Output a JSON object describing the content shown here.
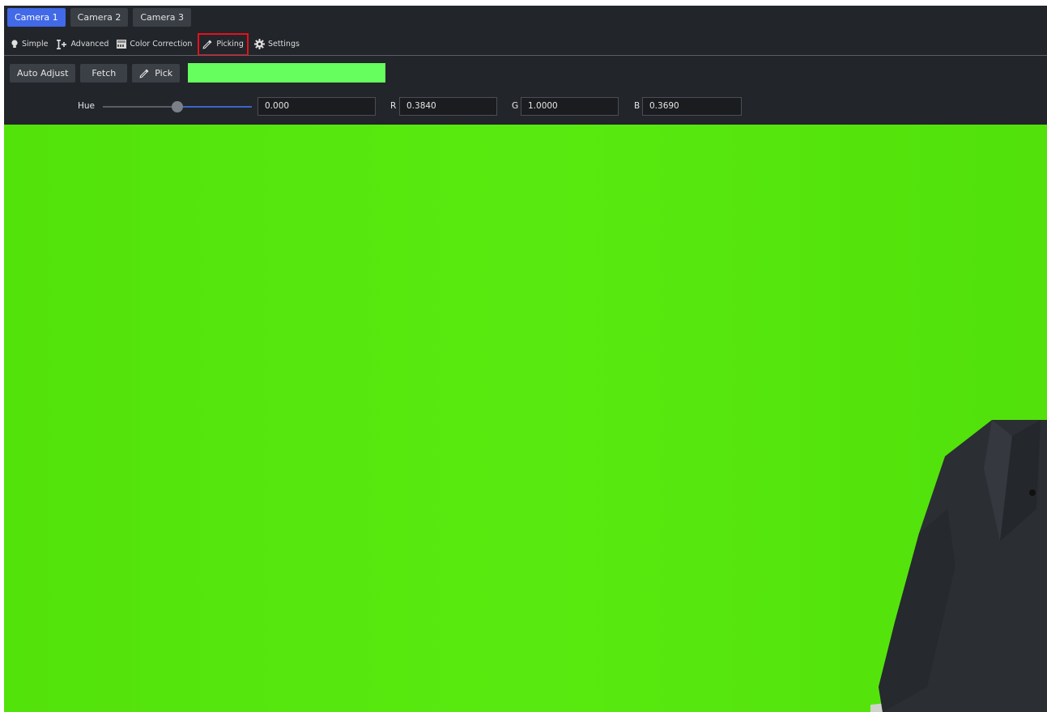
{
  "cameras": {
    "tabs": [
      {
        "label": "Camera 1",
        "active": true
      },
      {
        "label": "Camera 2",
        "active": false
      },
      {
        "label": "Camera 3",
        "active": false
      }
    ]
  },
  "modes": {
    "items": [
      {
        "label": "Simple",
        "icon": "lightbulb-icon"
      },
      {
        "label": "Advanced",
        "icon": "advanced-icon"
      },
      {
        "label": "Color Correction",
        "icon": "color-correction-icon"
      },
      {
        "label": "Picking",
        "icon": "eyedropper-icon",
        "selected": true
      },
      {
        "label": "Settings",
        "icon": "gear-icon"
      }
    ]
  },
  "picking": {
    "auto_adjust_label": "Auto Adjust",
    "fetch_label": "Fetch",
    "pick_label": "Pick",
    "picked_color": "#66fd5e"
  },
  "color": {
    "hue_label": "Hue",
    "hue_value": "0.000",
    "hue_slider_fraction": 0.5,
    "r_label": "R",
    "r_value": "0.3840",
    "g_label": "G",
    "g_value": "1.0000",
    "b_label": "B",
    "b_value": "0.3690"
  },
  "colors": {
    "accent": "#4169e8",
    "highlight_border": "#e8101b",
    "chroma_green": "#55ea0b"
  }
}
